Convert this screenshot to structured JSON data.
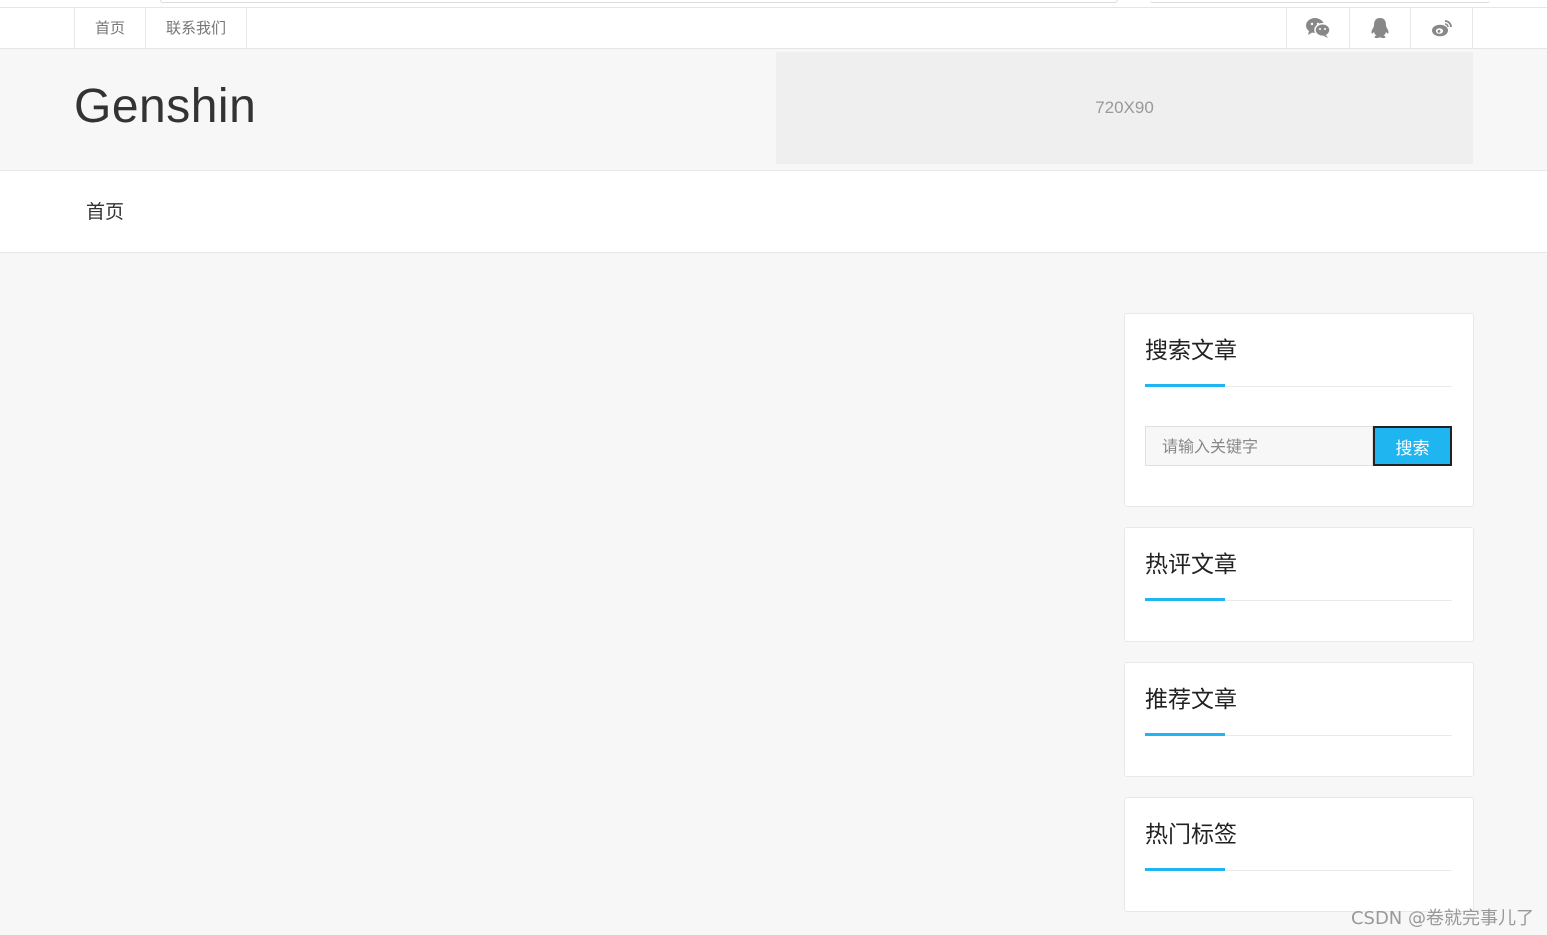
{
  "topnav": {
    "items": [
      {
        "label": "首页"
      },
      {
        "label": "联系我们"
      }
    ]
  },
  "social": {
    "icons": [
      "wechat-icon",
      "qq-icon",
      "weibo-icon"
    ],
    "icon_color": "#888888"
  },
  "header": {
    "site_title": "Genshin",
    "ad_label": "720X90"
  },
  "mainnav": {
    "home_label": "首页"
  },
  "sidebar": {
    "search": {
      "title": "搜索文章",
      "placeholder": "请输入关键字",
      "button_label": "搜索"
    },
    "hot_comments": {
      "title": "热评文章"
    },
    "recommended": {
      "title": "推荐文章"
    },
    "hot_tags": {
      "title": "热门标签"
    }
  },
  "watermark": "CSDN @卷就完事儿了",
  "colors": {
    "accent": "#1fb5f0",
    "page_bg": "#f7f7f7"
  }
}
